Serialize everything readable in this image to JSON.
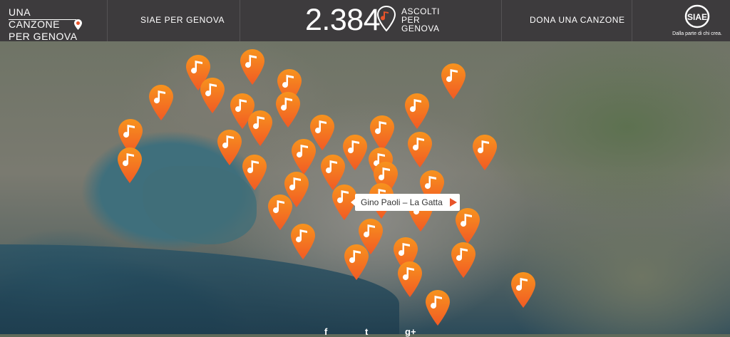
{
  "header": {
    "logo_line1": "UNA CANZONE",
    "logo_line2": "PER GENOVA",
    "nav_siae": "SIAE PER GENOVA",
    "counter": "2.384",
    "counter_label": [
      "ASCOLTI",
      "PER",
      "GENOVA"
    ],
    "nav_dona": "DONA UNA CANZONE",
    "siae_logo": "SIAE",
    "siae_tagline": "Dalla parte di chi crea."
  },
  "map": {
    "pin_icon": "music-note-icon",
    "pin_color": "#f15a24",
    "pin_color_light": "#f7931e",
    "tooltip": "Gino Paoli – La Gatta"
  },
  "social": {
    "facebook": "f",
    "twitter": "t",
    "googleplus": "g+"
  },
  "colors": {
    "topbar": "#3d3b3d",
    "accent": "#e8542a"
  }
}
